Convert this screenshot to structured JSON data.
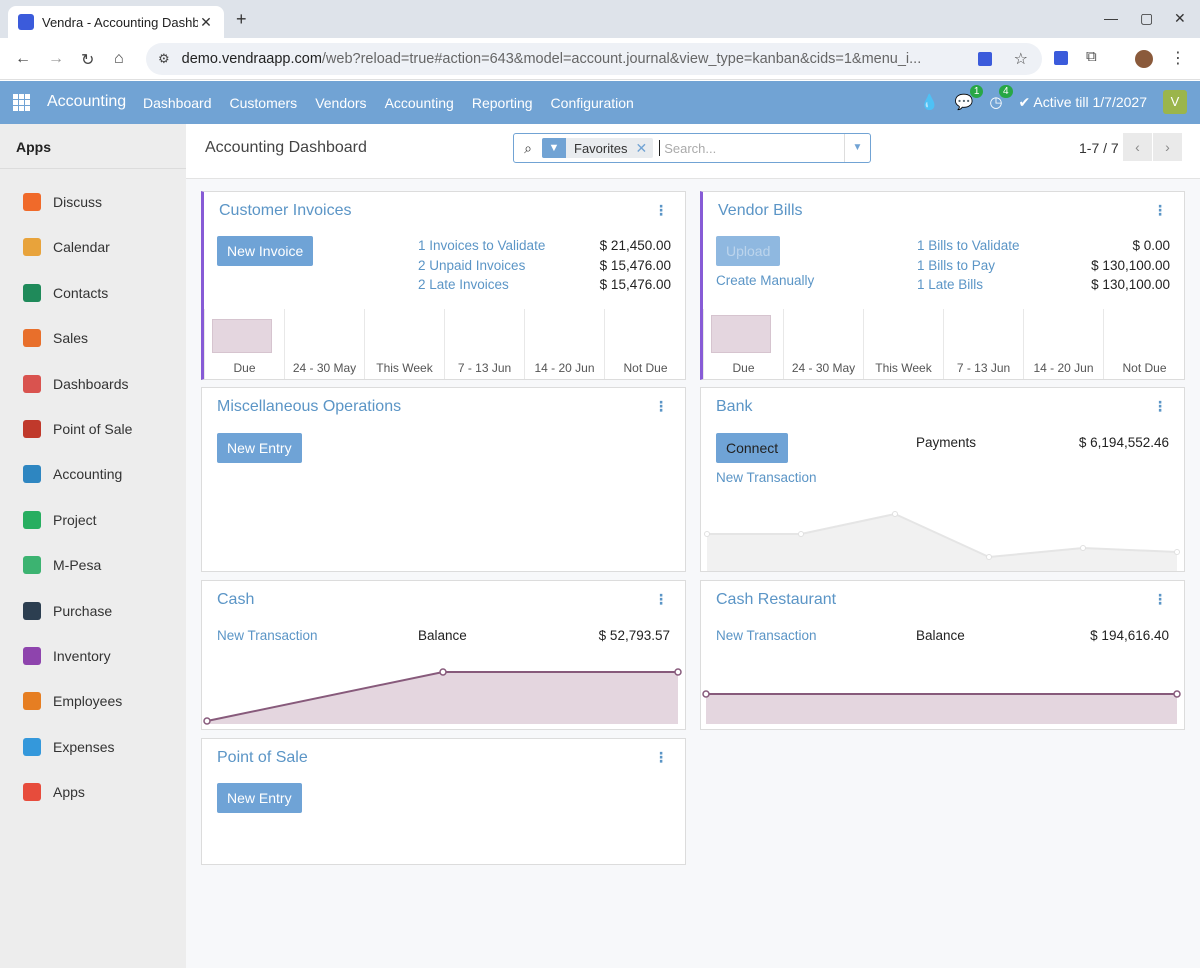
{
  "browser": {
    "tab_title": "Vendra - Accounting Dashboard",
    "url_host": "demo.vendraapp.com",
    "url_path": "/web?reload=true#action=643&model=account.journal&view_type=kanban&cids=1&menu_i..."
  },
  "navbar": {
    "app_name": "Accounting",
    "menu": [
      "Dashboard",
      "Customers",
      "Vendors",
      "Accounting",
      "Reporting",
      "Configuration"
    ],
    "messages_badge": "1",
    "activities_badge": "4",
    "status": "Active till 1/7/2027",
    "avatar_letter": "V"
  },
  "sidebar": {
    "title": "Apps",
    "items": [
      {
        "label": "Discuss",
        "color": "#f06a2a"
      },
      {
        "label": "Calendar",
        "color": "#e8a33b"
      },
      {
        "label": "Contacts",
        "color": "#1f8a5a"
      },
      {
        "label": "Sales",
        "color": "#e86f2b"
      },
      {
        "label": "Dashboards",
        "color": "#d9534f"
      },
      {
        "label": "Point of Sale",
        "color": "#c0392b"
      },
      {
        "label": "Accounting",
        "color": "#2e86c1"
      },
      {
        "label": "Project",
        "color": "#27ae60"
      },
      {
        "label": "M-Pesa",
        "color": "#3cb371"
      },
      {
        "label": "Purchase",
        "color": "#2c3e50"
      },
      {
        "label": "Inventory",
        "color": "#8e44ad"
      },
      {
        "label": "Employees",
        "color": "#e67e22"
      },
      {
        "label": "Expenses",
        "color": "#3498db"
      },
      {
        "label": "Apps",
        "color": "#e74c3c"
      }
    ]
  },
  "control_panel": {
    "breadcrumb": "Accounting Dashboard",
    "facet_label": "Favorites",
    "search_placeholder": "Search...",
    "pager": "1-7 / 7"
  },
  "cards": {
    "customer_invoices": {
      "title": "Customer Invoices",
      "button": "New Invoice",
      "rows": [
        {
          "label": "1 Invoices to Validate",
          "amount": "$ 21,450.00"
        },
        {
          "label": "2 Unpaid Invoices",
          "amount": "$ 15,476.00"
        },
        {
          "label": "2 Late Invoices",
          "amount": "$ 15,476.00"
        }
      ],
      "bars": [
        "Due",
        "24 - 30 May",
        "This Week",
        "7 - 13 Jun",
        "14 - 20 Jun",
        "Not Due"
      ]
    },
    "vendor_bills": {
      "title": "Vendor Bills",
      "button": "Upload",
      "create_link": "Create Manually",
      "rows": [
        {
          "label": "1 Bills to Validate",
          "amount": "$ 0.00"
        },
        {
          "label": "1 Bills to Pay",
          "amount": "$ 130,100.00"
        },
        {
          "label": "1 Late Bills",
          "amount": "$ 130,100.00"
        }
      ],
      "bars": [
        "Due",
        "24 - 30 May",
        "This Week",
        "7 - 13 Jun",
        "14 - 20 Jun",
        "Not Due"
      ]
    },
    "misc": {
      "title": "Miscellaneous Operations",
      "button": "New Entry"
    },
    "bank": {
      "title": "Bank",
      "button": "Connect",
      "link": "New Transaction",
      "label": "Payments",
      "amount": "$ 6,194,552.46"
    },
    "cash": {
      "title": "Cash",
      "link": "New Transaction",
      "label": "Balance",
      "amount": "$ 52,793.57"
    },
    "cash_restaurant": {
      "title": "Cash Restaurant",
      "link": "New Transaction",
      "label": "Balance",
      "amount": "$ 194,616.40"
    },
    "pos": {
      "title": "Point of Sale",
      "button": "New Entry"
    }
  }
}
